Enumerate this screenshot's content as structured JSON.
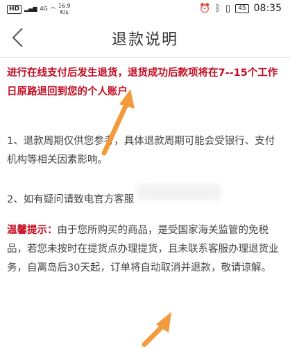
{
  "status_bar": {
    "hd": "HD",
    "signal": "4G",
    "speed_value": "16.9",
    "speed_unit": "K/s",
    "battery": "45",
    "time": "08:35"
  },
  "header": {
    "title": "退款说明"
  },
  "content": {
    "notice": "进行在线支付后发生退货，退货成功后款项将在7--15个工作日原路退回到您的个人账户。",
    "item1": "1、退款周期仅供您参考，具体退款周期可能会受银行、支付机构等相关因素影响。",
    "item2": "2、如有疑问请致电官方客服",
    "tip_label": "温馨提示：",
    "tip_text": "由于您所购买的商品，是受国家海关监管的免税品，若您未按时在提货点办理提货，且未联系客服办理退货业务，自离岛后30天起，订单将自动取消并退款，敬请谅解。"
  },
  "colors": {
    "notice_red": "#c30d23",
    "arrow_orange": "#f39a3c"
  }
}
